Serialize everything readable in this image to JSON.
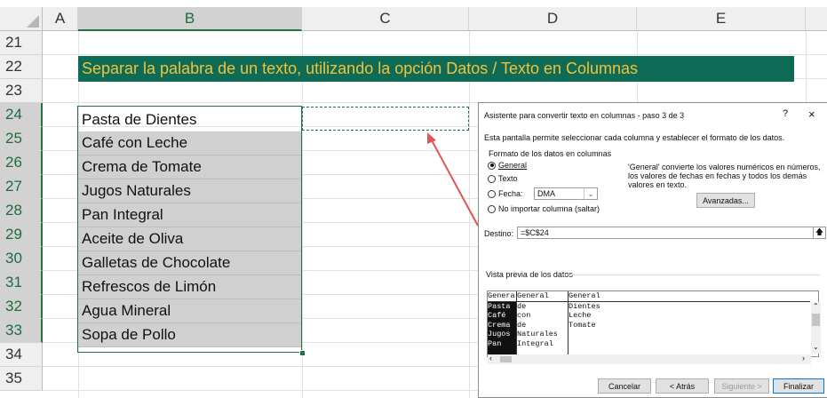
{
  "sheet": {
    "columns": [
      "A",
      "B",
      "C",
      "D",
      "E"
    ],
    "rows": [
      "21",
      "22",
      "23",
      "24",
      "25",
      "26",
      "27",
      "28",
      "29",
      "30",
      "31",
      "32",
      "33",
      "34",
      "35"
    ],
    "banner": "Separar la palabra de un texto, utilizando la opción Datos / Texto en Columnas",
    "cells": [
      "Pasta de Dientes",
      "Café con Leche",
      "Crema de Tomate",
      "Jugos Naturales",
      "Pan Integral",
      "Aceite de Oliva",
      "Galletas de Chocolate",
      "Refrescos de Limón",
      "Agua Mineral",
      "Sopa de Pollo"
    ],
    "colors": {
      "banner_bg": "#0e6b56",
      "banner_text": "#f3c23a",
      "selection": "#217346",
      "arrow": "#e05555"
    }
  },
  "dialog": {
    "title": "Asistente para convertir texto en columnas - paso 3 de 3",
    "help": "?",
    "close": "×",
    "intro": "Esta pantalla permite seleccionar cada columna y establecer el formato de los datos.",
    "format_legend": "Formato de los datos en columnas",
    "radios": [
      "General",
      "Texto",
      "Fecha:",
      "No importar columna (saltar)"
    ],
    "date_combo": "DMA",
    "note": "'General' convierte los valores numéricos en números, los valores de fechas en fechas y todos los demás valores en texto.",
    "advanced": "Avanzadas...",
    "dest_label": "Destino:",
    "dest_value": "=$C$24",
    "preview_label": "Vista previa de los datos",
    "preview": {
      "col1": [
        "Genera",
        "Pasta",
        "Café",
        "Crema",
        "Jugos",
        "Pan"
      ],
      "col2": [
        "General",
        "de",
        "con",
        "de",
        "Naturales",
        "Integral"
      ],
      "col3": [
        "General",
        "Dientes",
        "Leche",
        "Tomate",
        "",
        ""
      ]
    },
    "buttons": {
      "cancel": "Cancelar",
      "back": "< Atrás",
      "next": "Siguiente >",
      "finish": "Finalizar"
    }
  }
}
